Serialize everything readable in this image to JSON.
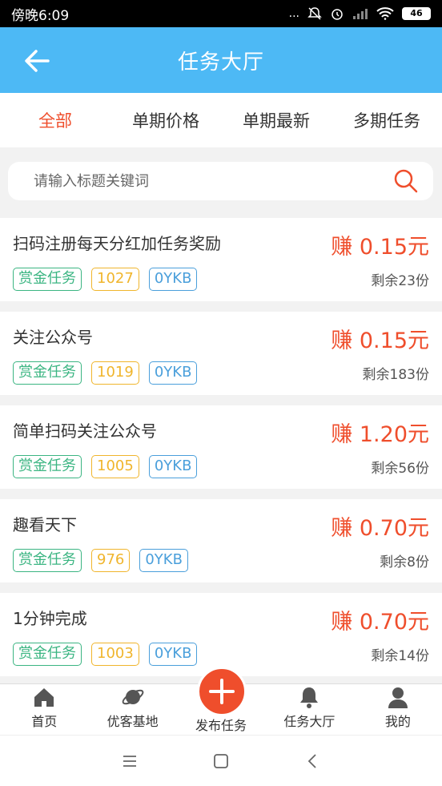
{
  "status": {
    "time": "傍晚6:09",
    "signal": "...",
    "battery": "46"
  },
  "header": {
    "title": "任务大厅"
  },
  "tabs": [
    "全部",
    "单期价格",
    "单期最新",
    "多期任务"
  ],
  "search": {
    "placeholder": "请输入标题关键词"
  },
  "tasks": [
    {
      "title": "扫码注册每天分红加任务奖励",
      "reward": "赚 0.15元",
      "tag1": "赏金任务",
      "tag2": "1027",
      "tag3": "0YKB",
      "remain": "剩余23份"
    },
    {
      "title": "关注公众号",
      "reward": "赚 0.15元",
      "tag1": "赏金任务",
      "tag2": "1019",
      "tag3": "0YKB",
      "remain": "剩余183份"
    },
    {
      "title": "简单扫码关注公众号",
      "reward": "赚 1.20元",
      "tag1": "赏金任务",
      "tag2": "1005",
      "tag3": "0YKB",
      "remain": "剩余56份"
    },
    {
      "title": "趣看天下",
      "reward": "赚 0.70元",
      "tag1": "赏金任务",
      "tag2": "976",
      "tag3": "0YKB",
      "remain": "剩余8份"
    },
    {
      "title": "1分钟完成",
      "reward": "赚 0.70元",
      "tag1": "赏金任务",
      "tag2": "1003",
      "tag3": "0YKB",
      "remain": "剩余14份"
    }
  ],
  "nav": {
    "home": "首页",
    "base": "优客基地",
    "publish": "发布任务",
    "hall": "任务大厅",
    "mine": "我的"
  },
  "colors": {
    "header": "#4db9f5",
    "accent": "#ef4e2c",
    "green": "#3bb582",
    "yellow": "#f0b52c",
    "blue": "#4a9fdb"
  },
  "icons": [
    "back-arrow-icon",
    "search-icon",
    "home-icon",
    "planet-icon",
    "plus-icon",
    "bell-icon",
    "person-icon"
  ]
}
